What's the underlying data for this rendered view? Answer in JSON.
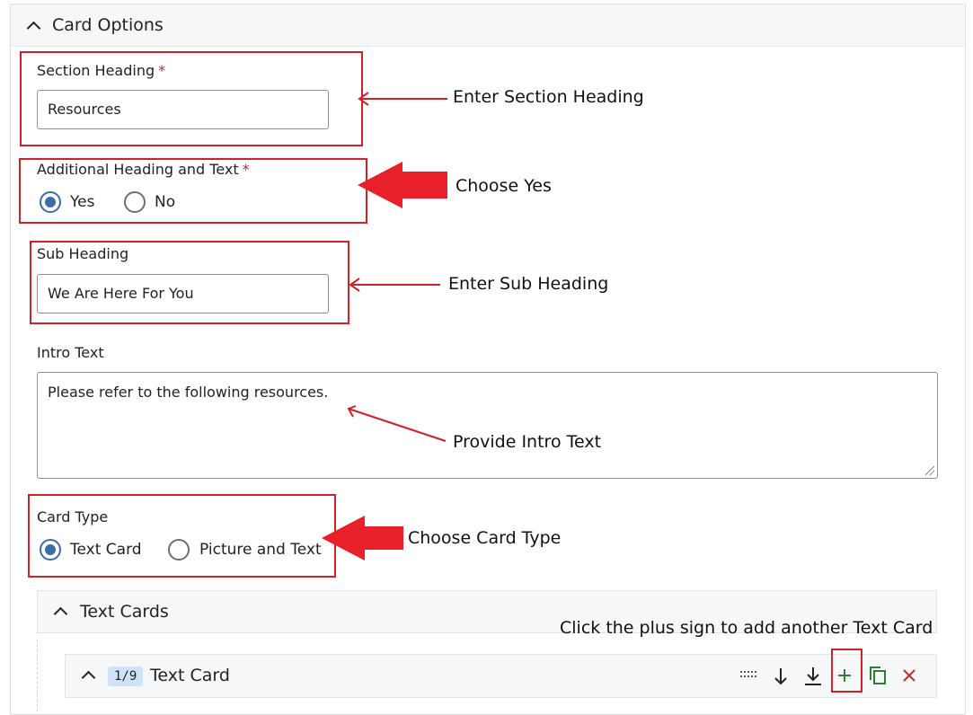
{
  "panel": {
    "title": "Card Options"
  },
  "section_heading": {
    "label": "Section Heading",
    "required": "*",
    "value": "Resources"
  },
  "additional": {
    "label": "Additional Heading and Text",
    "required": "*",
    "options": [
      {
        "label": "Yes",
        "selected": true
      },
      {
        "label": "No",
        "selected": false
      }
    ]
  },
  "sub_heading": {
    "label": "Sub Heading",
    "value": "We Are Here For You"
  },
  "intro": {
    "label": "Intro Text",
    "value": "Please refer to the following resources."
  },
  "card_type": {
    "label": "Card Type",
    "options": [
      {
        "label": "Text Card",
        "selected": true
      },
      {
        "label": "Picture and Text",
        "selected": false
      }
    ]
  },
  "text_cards": {
    "title": "Text Cards",
    "item": {
      "badge": "1/9",
      "title": "Text Card"
    }
  },
  "annotations": {
    "enter_section_heading": "Enter Section Heading",
    "choose_yes": "Choose Yes",
    "enter_sub_heading": "Enter Sub Heading",
    "provide_intro": "Provide Intro Text",
    "choose_card_type": "Choose Card Type",
    "plus_hint": "Click the plus sign to add another Text Card"
  },
  "colors": {
    "annotation_red": "#d0202a",
    "radio_selected": "#3a6ea5",
    "add_green": "#2e7d32",
    "delete_red": "#c62828"
  },
  "icons": {
    "collapse": "chevron-up-icon",
    "drag": "drag-handle-icon",
    "down": "arrow-down-icon",
    "to_bottom": "arrow-to-bottom-icon",
    "add": "plus-icon",
    "copy": "copy-icon",
    "delete": "close-icon"
  }
}
